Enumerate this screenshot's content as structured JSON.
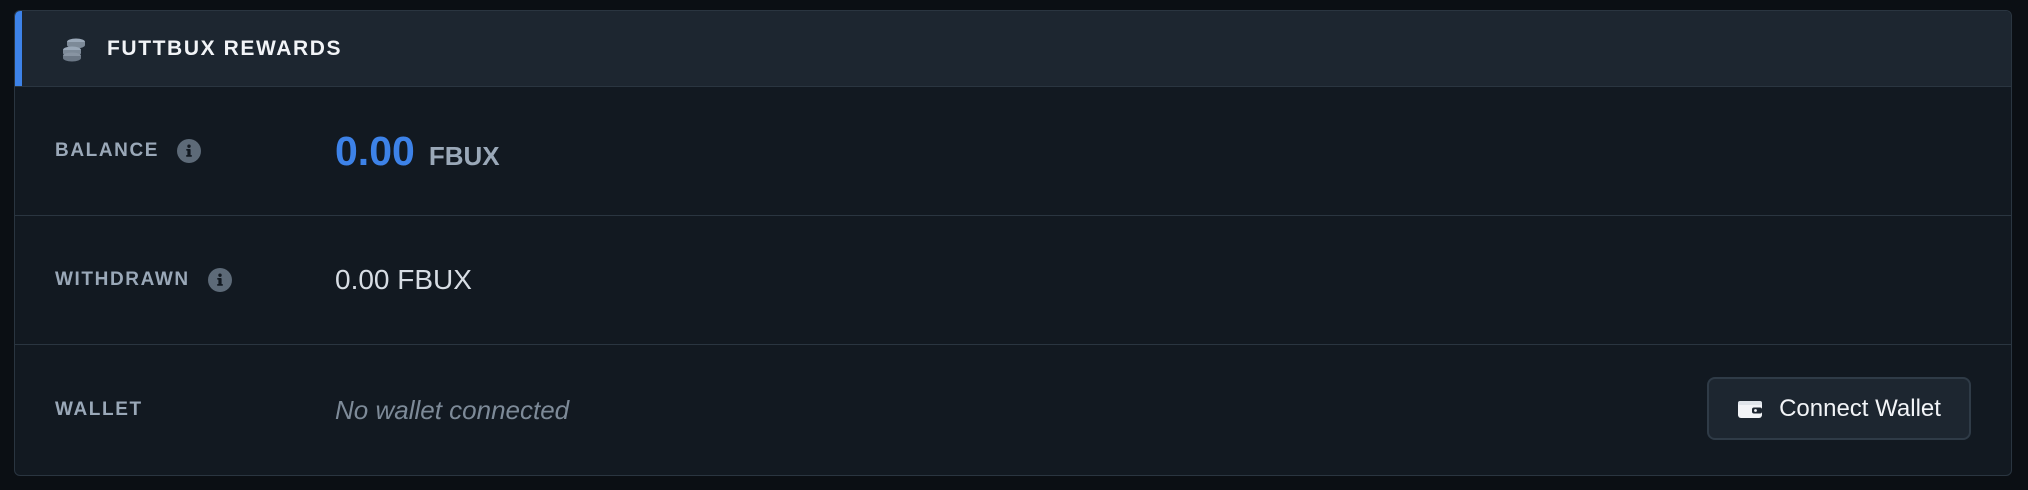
{
  "header": {
    "title": "FUTTBUX REWARDS",
    "icon": "coins-icon"
  },
  "balance": {
    "label": "BALANCE",
    "amount": "0.00",
    "unit": "FBUX",
    "amount_color": "#3d82e8"
  },
  "withdrawn": {
    "label": "WITHDRAWN",
    "value": "0.00 FBUX"
  },
  "wallet": {
    "label": "WALLET",
    "status": "No wallet connected",
    "connect_label": "Connect Wallet",
    "button_icon": "wallet-icon"
  },
  "colors": {
    "accent": "#3d82e8",
    "panel_bg": "#121921",
    "header_bg": "#1d2630"
  }
}
